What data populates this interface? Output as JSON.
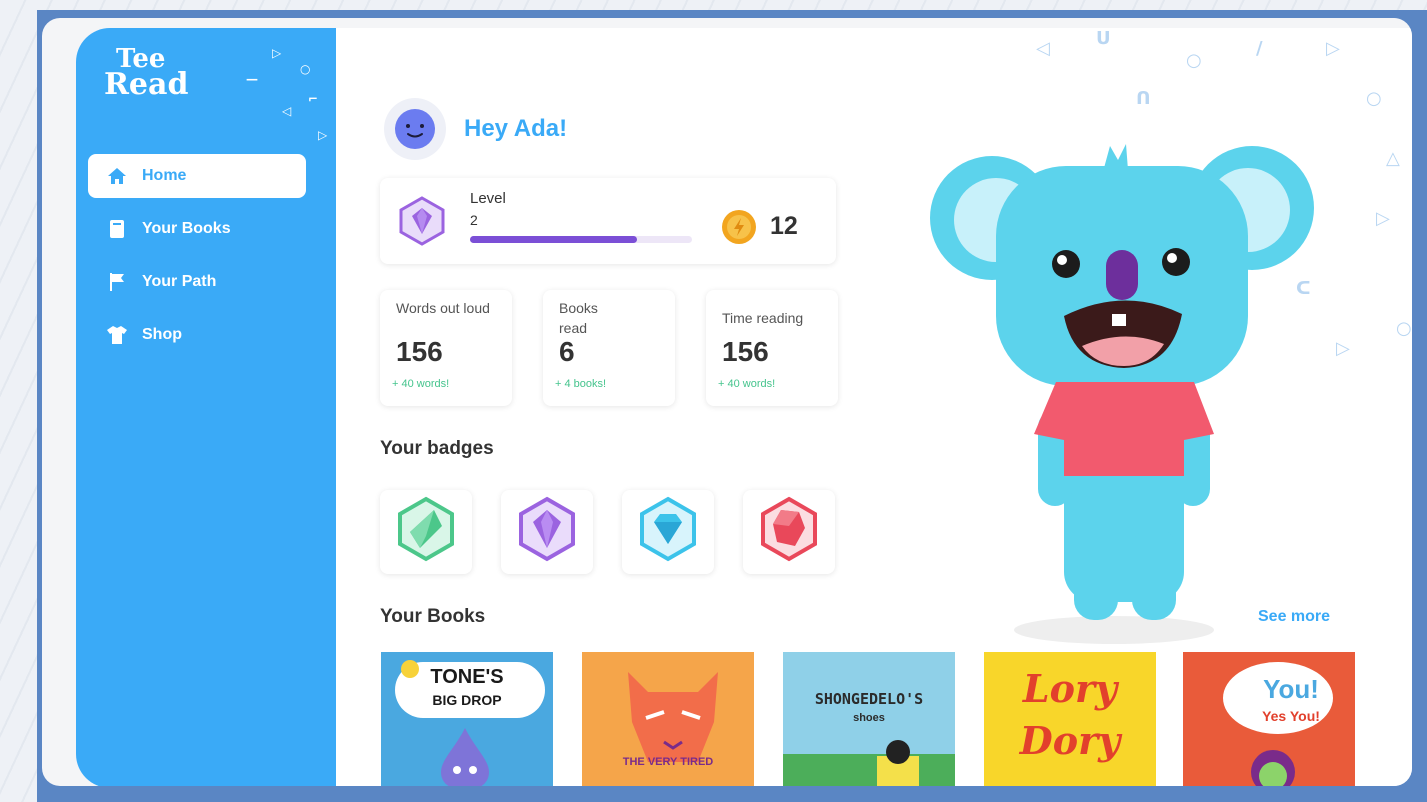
{
  "app": {
    "logo_line1": "Tee",
    "logo_line2": "Read",
    "brand_color": "#3aaaf7"
  },
  "sidebar": {
    "items": [
      {
        "label": "Home",
        "icon": "home-icon",
        "active": true
      },
      {
        "label": "Your Books",
        "icon": "book-icon",
        "active": false
      },
      {
        "label": "Your Path",
        "icon": "flag-icon",
        "active": false
      },
      {
        "label": "Shop",
        "icon": "tshirt-icon",
        "active": false
      }
    ]
  },
  "greeting": {
    "text": "Hey Ada!"
  },
  "level": {
    "label": "Level",
    "value": "2",
    "progress_percent": 75,
    "coins": "12"
  },
  "stats": [
    {
      "label": "Words out loud",
      "value": "156",
      "delta": "+ 40 words!"
    },
    {
      "label": "Books read",
      "value": "6",
      "delta": "+ 4 books!"
    },
    {
      "label": "Time reading",
      "value": "156",
      "delta": "+ 40 words!"
    }
  ],
  "badges": {
    "title": "Your badges",
    "items": [
      {
        "icon": "green-crystal-icon",
        "color": "#4cc78a"
      },
      {
        "icon": "purple-gem-icon",
        "color": "#9b63e0"
      },
      {
        "icon": "blue-diamond-icon",
        "color": "#3cc3ea"
      },
      {
        "icon": "red-ruby-icon",
        "color": "#e9485a"
      }
    ]
  },
  "books": {
    "title": "Your Books",
    "see_more": "See more",
    "items": [
      {
        "title": "TONE'S",
        "subtitle": "BIG DROP",
        "bg": "#4aa8e0"
      },
      {
        "title": "THE VERY TIRED",
        "subtitle": "",
        "bg": "#f5a54a"
      },
      {
        "title": "SHONGEDELO'S",
        "subtitle": "shoes",
        "bg": "#8fd0e8"
      },
      {
        "title": "Lory",
        "subtitle": "Dory",
        "bg": "#f8d62a"
      },
      {
        "title": "You!",
        "subtitle": "Yes You!",
        "bg": "#e95b3a"
      }
    ]
  }
}
